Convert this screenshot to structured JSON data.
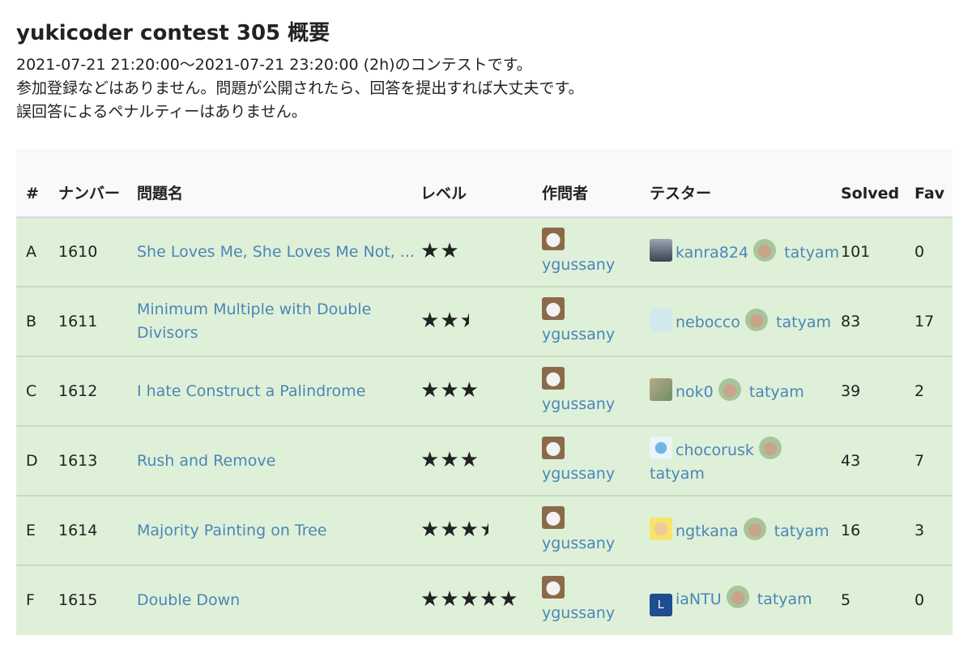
{
  "page": {
    "title": "yukicoder contest 305 概要",
    "desc": [
      "2021-07-21 21:20:00〜2021-07-21 23:20:00 (2h)のコンテストです。",
      "参加登録などはありません。問題が公開されたら、回答を提出すれば大丈夫です。",
      "誤回答によるペナルティーはありません。"
    ]
  },
  "table": {
    "headers": {
      "id": "#",
      "number": "ナンバー",
      "name": "問題名",
      "level": "レベル",
      "author": "作問者",
      "tester": "テスター",
      "solved": "Solved",
      "fav": "Fav"
    },
    "rows": [
      {
        "id": "A",
        "number": "1610",
        "name": "She Loves Me, She Loves Me Not, ...",
        "level": 2,
        "author": "ygussany",
        "testers": [
          "kanra824",
          "tatyam"
        ],
        "solved": "101",
        "fav": "0"
      },
      {
        "id": "B",
        "number": "1611",
        "name": "Minimum Multiple with Double Divisors",
        "level": 2.5,
        "author": "ygussany",
        "testers": [
          "nebocco",
          "tatyam"
        ],
        "solved": "83",
        "fav": "17"
      },
      {
        "id": "C",
        "number": "1612",
        "name": "I hate Construct a Palindrome",
        "level": 3,
        "author": "ygussany",
        "testers": [
          "nok0",
          "tatyam"
        ],
        "solved": "39",
        "fav": "2"
      },
      {
        "id": "D",
        "number": "1613",
        "name": "Rush and Remove",
        "level": 3,
        "author": "ygussany",
        "testers": [
          "chocorusk",
          "tatyam"
        ],
        "solved": "43",
        "fav": "7"
      },
      {
        "id": "E",
        "number": "1614",
        "name": "Majority Painting on Tree",
        "level": 3.5,
        "author": "ygussany",
        "testers": [
          "ngtkana",
          "tatyam"
        ],
        "solved": "16",
        "fav": "3"
      },
      {
        "id": "F",
        "number": "1615",
        "name": "Double Down",
        "level": 5,
        "author": "ygussany",
        "testers": [
          "iaNTU",
          "tatyam"
        ],
        "solved": "5",
        "fav": "0"
      }
    ]
  },
  "avatars": {
    "ygussany": "sheep-avatar-icon",
    "kanra824": "landscape-avatar-icon",
    "nebocco": "glasses-avatar-icon",
    "nok0": "photo-avatar-icon",
    "chocorusk": "blue-character-avatar-icon",
    "ngtkana": "anime-avatar-icon",
    "iaNTU": "letter-avatar-icon",
    "iaNTU_letter": "L",
    "tatyam": "anime-girl-avatar-icon"
  },
  "colors": {
    "row_bg": "#dff0d8",
    "link": "#4a86b8",
    "header_bg": "#f9f9f9"
  }
}
